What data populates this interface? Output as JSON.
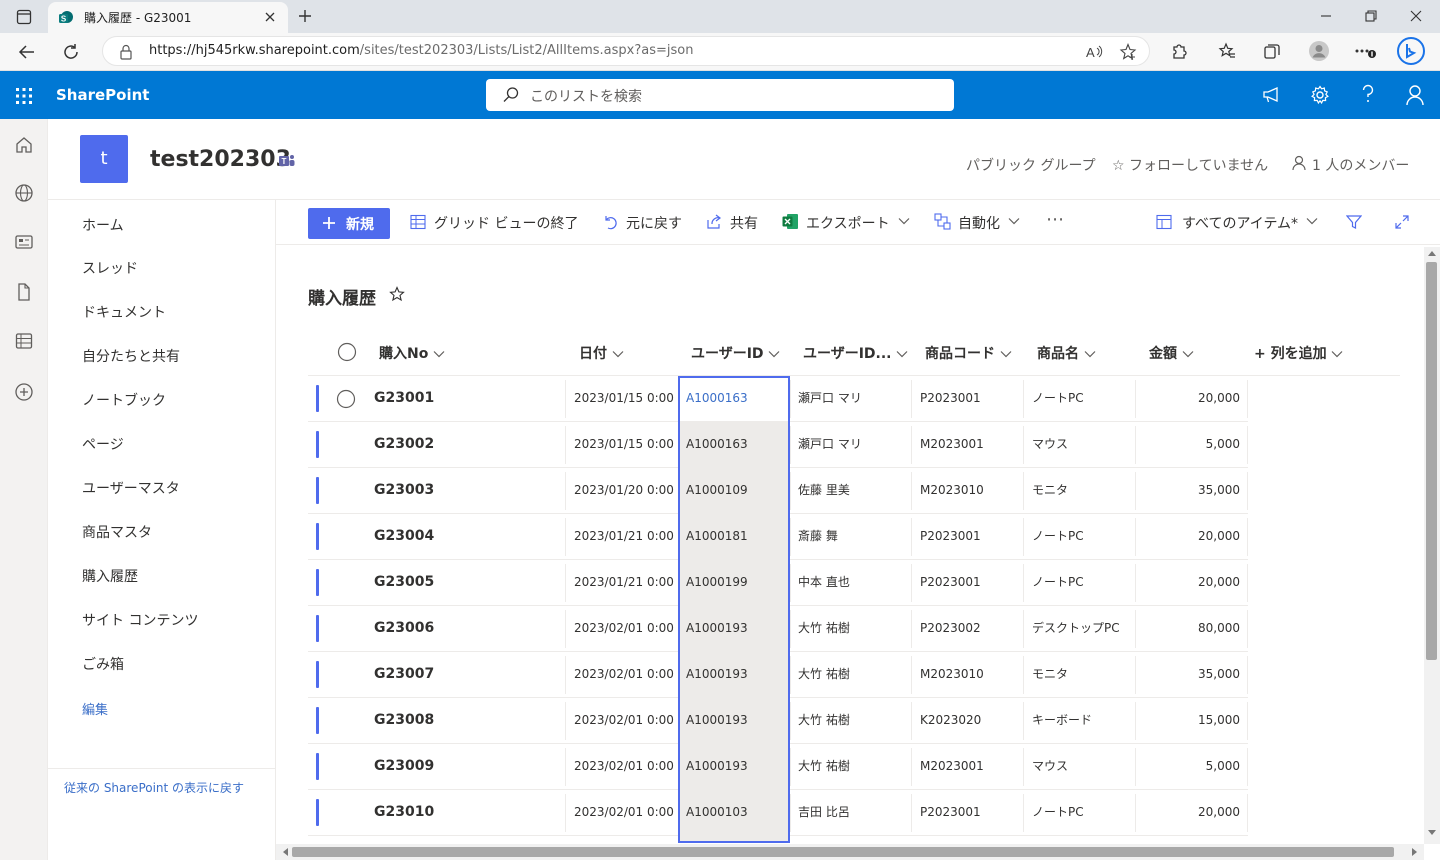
{
  "browser": {
    "tab_title": "購入履歴 - G23001",
    "url_host": "https://hj545rkw.sharepoint.com",
    "url_path": "/sites/test202303/Lists/List2/AllItems.aspx?as=json"
  },
  "suitebar": {
    "brand": "SharePoint",
    "search_placeholder": "このリストを検索",
    "accent": "#0078d4"
  },
  "site": {
    "logo_letter": "t",
    "title": "test202303",
    "group_label": "パブリック グループ",
    "follow_label": "☆ フォローしていません",
    "members_label": "1 人のメンバー"
  },
  "nav": {
    "items": [
      "ホーム",
      "スレッド",
      "ドキュメント",
      "自分たちと共有",
      "ノートブック",
      "ページ",
      "ユーザーマスタ",
      "商品マスタ",
      "購入履歴",
      "サイト コンテンツ",
      "ごみ箱"
    ],
    "edit_label": "編集",
    "classic_link": "従来の SharePoint の表示に戻す"
  },
  "commands": {
    "new": "新規",
    "exit_grid": "グリッド ビューの終了",
    "undo": "元に戻す",
    "share": "共有",
    "export": "エクスポート",
    "automate": "自動化",
    "more": "⋯",
    "view": "すべてのアイテム*"
  },
  "list": {
    "title": "購入履歴",
    "columns": [
      "購入No",
      "日付",
      "ユーザーID",
      "ユーザーID...",
      "商品コード",
      "商品名",
      "金額",
      "+ 列を追加"
    ],
    "rows": [
      {
        "no": "G23001",
        "date": "2023/01/15 0:00",
        "uid": "A1000163",
        "uname": "瀬戸口 マリ",
        "pcode": "P2023001",
        "pname": "ノートPC",
        "amount": "20,000"
      },
      {
        "no": "G23002",
        "date": "2023/01/15 0:00",
        "uid": "A1000163",
        "uname": "瀬戸口 マリ",
        "pcode": "M2023001",
        "pname": "マウス",
        "amount": "5,000"
      },
      {
        "no": "G23003",
        "date": "2023/01/20 0:00",
        "uid": "A1000109",
        "uname": "佐藤 里美",
        "pcode": "M2023010",
        "pname": "モニタ",
        "amount": "35,000"
      },
      {
        "no": "G23004",
        "date": "2023/01/21 0:00",
        "uid": "A1000181",
        "uname": "斎藤 舞",
        "pcode": "P2023001",
        "pname": "ノートPC",
        "amount": "20,000"
      },
      {
        "no": "G23005",
        "date": "2023/01/21 0:00",
        "uid": "A1000199",
        "uname": "中本 直也",
        "pcode": "P2023001",
        "pname": "ノートPC",
        "amount": "20,000"
      },
      {
        "no": "G23006",
        "date": "2023/02/01 0:00",
        "uid": "A1000193",
        "uname": "大竹 祐樹",
        "pcode": "P2023002",
        "pname": "デスクトップPC",
        "amount": "80,000"
      },
      {
        "no": "G23007",
        "date": "2023/02/01 0:00",
        "uid": "A1000193",
        "uname": "大竹 祐樹",
        "pcode": "M2023010",
        "pname": "モニタ",
        "amount": "35,000"
      },
      {
        "no": "G23008",
        "date": "2023/02/01 0:00",
        "uid": "A1000193",
        "uname": "大竹 祐樹",
        "pcode": "K2023020",
        "pname": "キーボード",
        "amount": "15,000"
      },
      {
        "no": "G23009",
        "date": "2023/02/01 0:00",
        "uid": "A1000193",
        "uname": "大竹 祐樹",
        "pcode": "M2023001",
        "pname": "マウス",
        "amount": "5,000"
      },
      {
        "no": "G23010",
        "date": "2023/02/01 0:00",
        "uid": "A1000103",
        "uname": "吉田 比呂",
        "pcode": "P2023001",
        "pname": "ノートPC",
        "amount": "20,000"
      }
    ]
  }
}
